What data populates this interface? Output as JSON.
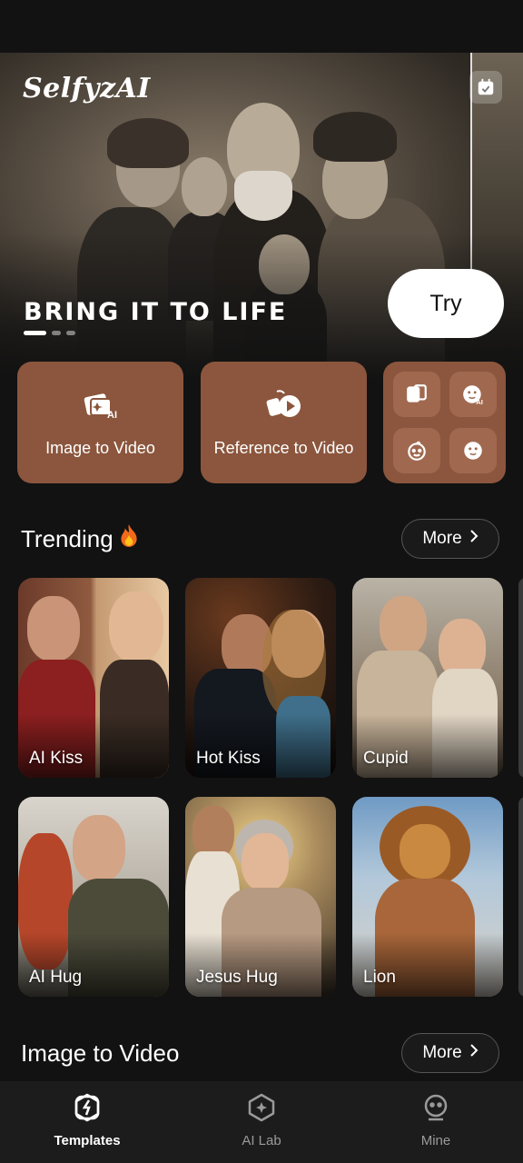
{
  "hero": {
    "brand": "SelfyzAI",
    "tagline": "BRING IT TO LIFE",
    "try_label": "Try",
    "active_slide": 1,
    "slide_count": 3
  },
  "features": {
    "image_to_video": "Image to Video",
    "reference_to_video": "Reference to Video",
    "mini_tools": [
      "face-swap-icon",
      "ai-face-icon",
      "baby-face-icon",
      "emoji-face-icon"
    ]
  },
  "trending": {
    "title": "Trending",
    "more_label": "More",
    "cards": [
      {
        "label": "AI Kiss"
      },
      {
        "label": "Hot Kiss"
      },
      {
        "label": "Cupid"
      },
      {
        "label": "AI Hug"
      },
      {
        "label": "Jesus Hug"
      },
      {
        "label": "Lion"
      }
    ]
  },
  "image_to_video_section": {
    "title": "Image to Video",
    "more_label": "More"
  },
  "nav": {
    "items": [
      {
        "label": "Templates",
        "icon": "templates-icon",
        "active": true
      },
      {
        "label": "AI Lab",
        "icon": "ai-lab-icon",
        "active": false
      },
      {
        "label": "Mine",
        "icon": "mine-icon",
        "active": false
      }
    ]
  },
  "colors": {
    "background": "#121212",
    "feature_card": "#8b563d",
    "nav_bg": "#1c1c1c"
  }
}
